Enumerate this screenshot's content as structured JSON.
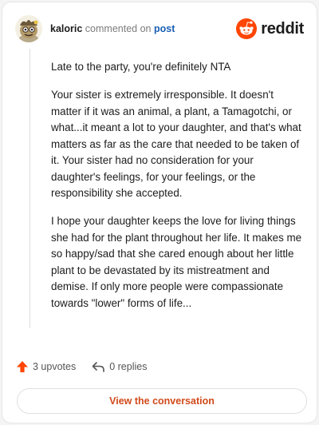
{
  "header": {
    "username": "kaloric",
    "action_text": "commented on",
    "post_link": "post",
    "brand_name": "reddit"
  },
  "comment": {
    "paragraphs": [
      "Late to the party, you're definitely NTA",
      "Your sister is extremely irresponsible. It doesn't matter if it was an animal, a plant, a Tamagotchi, or what...it meant a lot to your daughter, and that's what matters as far as the care that needed to be taken of it. Your sister had no consideration for your daughter's feelings, for your feelings, or the responsibility she accepted.",
      "I hope your daughter keeps the love for living things she had for the plant throughout her life. It makes me so happy/sad that she cared enough about her little plant to be devastated by its mistreatment and demise. If only more people were compassionate towards \"lower\" forms of life..."
    ]
  },
  "actions": {
    "upvotes": "3 upvotes",
    "replies": "0 replies"
  },
  "footer": {
    "view_button": "View the conversation"
  },
  "colors": {
    "brand_orange": "#ff4500",
    "link_blue": "#1a5fb4",
    "button_text": "#d14a1b",
    "thread_line": "#dcdcdc"
  },
  "icons": {
    "avatar": "user-avatar",
    "brand": "reddit-snoo-icon",
    "upvote": "upvote-arrow-icon",
    "reply": "reply-arrow-icon"
  }
}
